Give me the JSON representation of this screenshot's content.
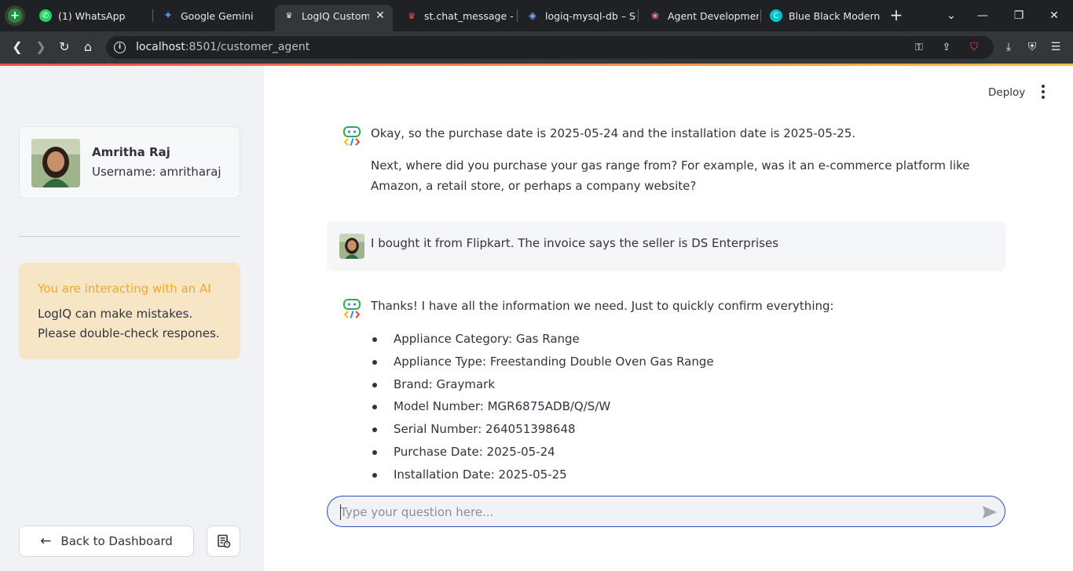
{
  "browser": {
    "tabs": [
      {
        "title": "(1) WhatsApp",
        "color": "#25d366"
      },
      {
        "title": "Google Gemini",
        "color": "#4285f4"
      },
      {
        "title": "LogIQ Customer Agent",
        "color": "#35363a"
      },
      {
        "title": "st.chat_message - Streamlit Docs",
        "color": "#ff4b4b"
      },
      {
        "title": "logiq-mysql-db – SQL",
        "color": "#4285f4"
      },
      {
        "title": "Agent Development Kit",
        "color": "#34a853"
      },
      {
        "title": "Blue Black Modern Presentation",
        "color": "#00c4cc"
      }
    ],
    "url_host": "localhost",
    "url_rest": ":8501/customer_agent"
  },
  "sidebar": {
    "profile_name": "Amritha Raj",
    "profile_username": "Username: amritharaj",
    "warning_title": "You are interacting with an AI",
    "warning_body": "LogIQ can make mistakes. Please double-check respones.",
    "back_button": "Back to Dashboard"
  },
  "header": {
    "deploy_label": "Deploy"
  },
  "chat": {
    "bot_msg1_p1": "Okay, so the purchase date is 2025-05-24 and the installation date is 2025-05-25.",
    "bot_msg1_p2": "Next, where did you purchase your gas range from? For example, was it an e-commerce platform like Amazon, a retail store, or perhaps a company website?",
    "user_msg": "I bought it from Flipkart. The invoice says the seller is DS Enterprises",
    "bot_msg2_intro": "Thanks! I have all the information we need. Just to quickly confirm everything:",
    "bot_msg2_items": [
      "Appliance Category: Gas Range",
      "Appliance Type: Freestanding Double Oven Gas Range",
      "Brand: Graymark",
      "Model Number: MGR6875ADB/Q/S/W",
      "Serial Number: 264051398648",
      "Purchase Date: 2025-05-24",
      "Installation Date: 2025-05-25"
    ],
    "input_placeholder": "Type your question here..."
  },
  "colors": {
    "accent": "#ff4b4b",
    "warning_title": "#eea825",
    "warning_bg": "#f7e6c6",
    "input_border": "#2a4fb0"
  }
}
